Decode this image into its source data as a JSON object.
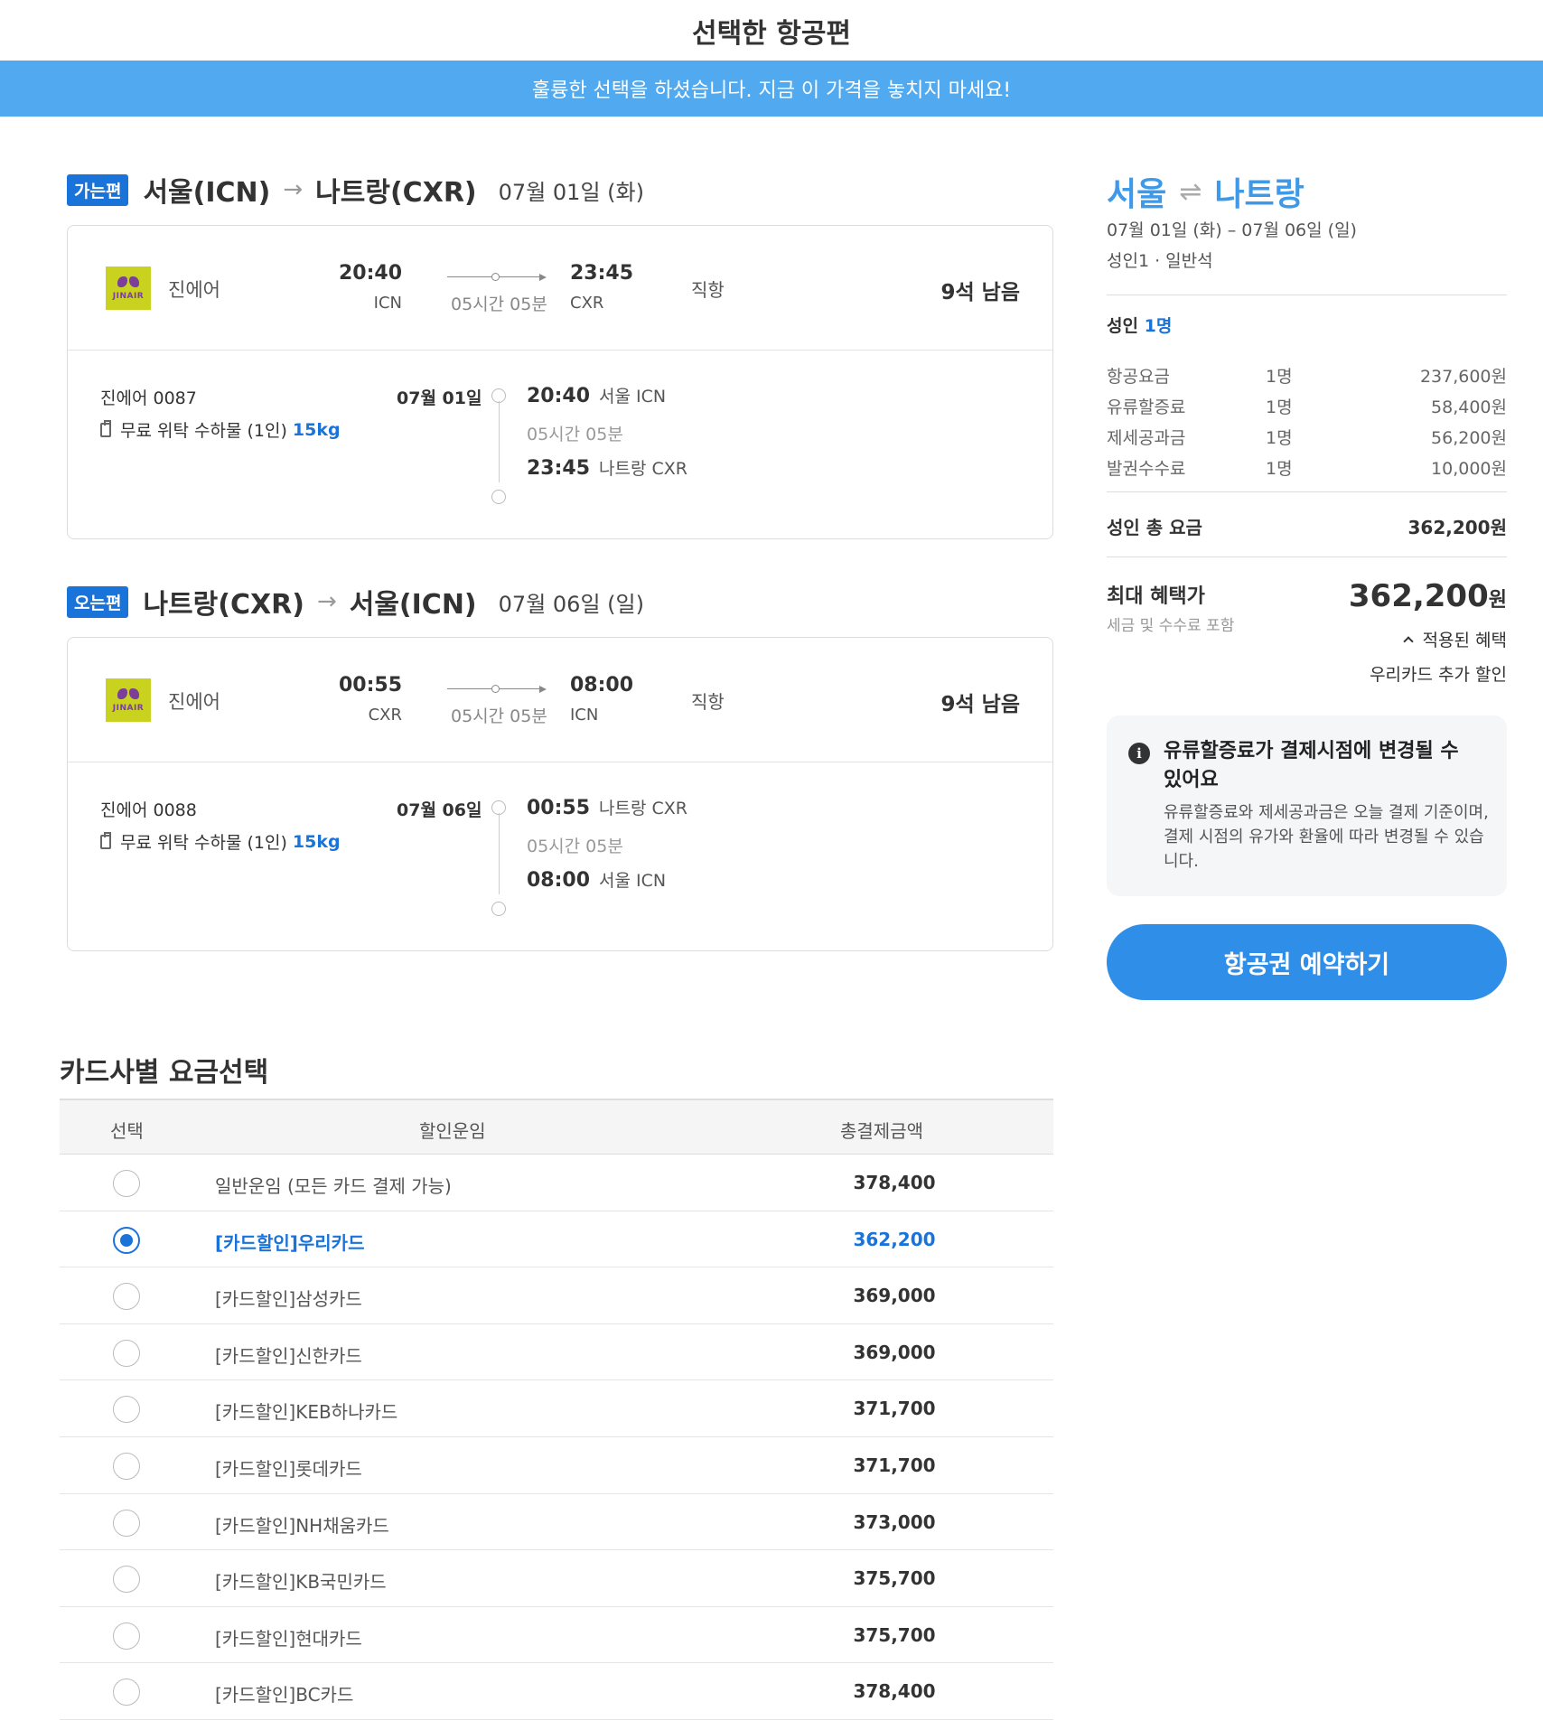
{
  "page": {
    "title": "선택한 항공편",
    "banner": "훌륭한 선택을 하셨습니다. 지금 이 가격을 놓치지 마세요!"
  },
  "outbound": {
    "tag": "가는편",
    "from": "서울(ICN)",
    "to": "나트랑(CXR)",
    "date": "07월 01일 (화)",
    "airline": "진에어",
    "logo_text": "JINAIR",
    "dep_time": "20:40",
    "dep_code": "ICN",
    "arr_time": "23:45",
    "arr_code": "CXR",
    "duration": "05시간 05분",
    "direct": "직항",
    "seats": "9석 남음",
    "flight_no": "진에어 0087",
    "baggage": "무료 위탁 수하물 (1인)",
    "baggage_kg": "15kg",
    "seg_date": "07월 01일",
    "seg_dep_time": "20:40",
    "seg_dep_place": "서울 ICN",
    "seg_duration": "05시간 05분",
    "seg_arr_time": "23:45",
    "seg_arr_place": "나트랑 CXR"
  },
  "inbound": {
    "tag": "오는편",
    "from": "나트랑(CXR)",
    "to": "서울(ICN)",
    "date": "07월 06일 (일)",
    "airline": "진에어",
    "logo_text": "JINAIR",
    "dep_time": "00:55",
    "dep_code": "CXR",
    "arr_time": "08:00",
    "arr_code": "ICN",
    "duration": "05시간 05분",
    "direct": "직항",
    "seats": "9석 남음",
    "flight_no": "진에어 0088",
    "baggage": "무료 위탁 수하물 (1인)",
    "baggage_kg": "15kg",
    "seg_date": "07월 06일",
    "seg_dep_time": "00:55",
    "seg_dep_place": "나트랑 CXR",
    "seg_duration": "05시간 05분",
    "seg_arr_time": "08:00",
    "seg_arr_place": "서울 ICN"
  },
  "summary": {
    "from": "서울",
    "to": "나트랑",
    "dates": "07월 01일 (화) – 07월 06일 (일)",
    "pax": "성인1 · 일반석",
    "adult_label": "성인",
    "adult_count": "1명",
    "fees": [
      {
        "name": "항공요금",
        "count": "1명",
        "amount": "237,600원"
      },
      {
        "name": "유류할증료",
        "count": "1명",
        "amount": "58,400원"
      },
      {
        "name": "제세공과금",
        "count": "1명",
        "amount": "56,200원"
      },
      {
        "name": "발권수수료",
        "count": "1명",
        "amount": "10,000원"
      }
    ],
    "total_label": "성인 총 요금",
    "total_value": "362,200원",
    "max_label": "최대 혜택가",
    "max_sub": "세금 및 수수료 포함",
    "max_price": "362,200",
    "max_won": "원",
    "applied_label": "적용된 혜택",
    "applied_benefit": "우리카드 추가 할인",
    "notice_title": "유류할증료가 결제시점에 변경될 수 있어요",
    "notice_body": "유류할증료와 제세공과금은 오늘 결제 기준이며, 결제 시점의 유가와 환율에 따라 변경될 수 있습니다.",
    "book_button": "항공권 예약하기"
  },
  "fares": {
    "title": "카드사별 요금선택",
    "col_select": "선택",
    "col_fare": "할인운임",
    "col_total": "총결제금액",
    "rows": [
      {
        "name": "일반운임 (모든 카드 결제 가능)",
        "amount": "378,400"
      },
      {
        "name": "[카드할인]우리카드",
        "amount": "362,200"
      },
      {
        "name": "[카드할인]삼성카드",
        "amount": "369,000"
      },
      {
        "name": "[카드할인]신한카드",
        "amount": "369,000"
      },
      {
        "name": "[카드할인]KEB하나카드",
        "amount": "371,700"
      },
      {
        "name": "[카드할인]롯데카드",
        "amount": "371,700"
      },
      {
        "name": "[카드할인]NH채움카드",
        "amount": "373,000"
      },
      {
        "name": "[카드할인]KB국민카드",
        "amount": "375,700"
      },
      {
        "name": "[카드할인]현대카드",
        "amount": "375,700"
      },
      {
        "name": "[카드할인]BC카드",
        "amount": "378,400"
      }
    ]
  },
  "colors": {
    "banner": "#51aaef",
    "accent": "#1a73d9",
    "button": "#2f8ee8",
    "logo": "#c9d31f"
  }
}
